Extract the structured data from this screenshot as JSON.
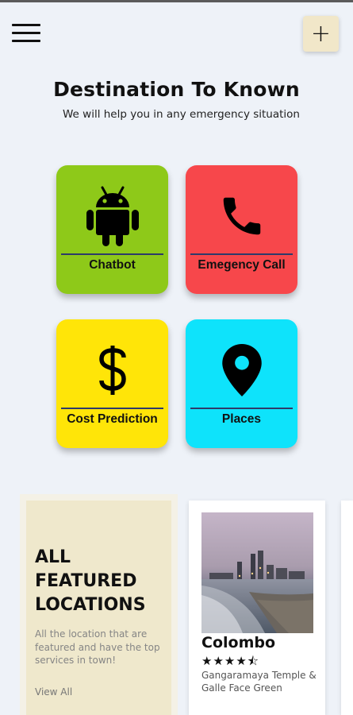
{
  "header": {
    "menu_icon": "hamburger-menu-icon",
    "add_label": "+"
  },
  "hero": {
    "title": "Destination To Known",
    "subtitle": "We will help you in any emergency situation"
  },
  "tiles": [
    {
      "label": "Chatbot",
      "icon": "android-icon",
      "color": "#8ec919"
    },
    {
      "label": "Emegency Call",
      "icon": "phone-icon",
      "color": "#f7474b"
    },
    {
      "label": "Cost Prediction",
      "icon": "dollar-icon",
      "color": "#ffe508"
    },
    {
      "label": "Places",
      "icon": "location-pin-icon",
      "color": "#0ee3fb"
    }
  ],
  "featured": {
    "title_lines": [
      "ALL",
      "FEATURED",
      "LOCATIONS"
    ],
    "description": "All the location that are featured and have the top services in town!",
    "view_all": "View All"
  },
  "location_card": {
    "name": "Colombo",
    "stars": "★★★★⯪",
    "rating": 4.5,
    "description": "Gangaramaya Temple & Galle Face Green"
  }
}
